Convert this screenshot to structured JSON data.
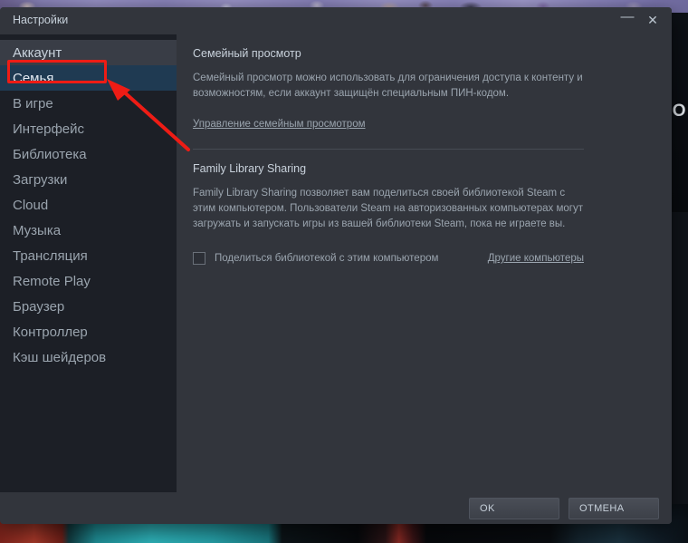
{
  "backdrop": {
    "visible_text_right": "НО"
  },
  "window": {
    "title": "Настройки",
    "controls": {
      "minimize": "—",
      "close": "✕"
    }
  },
  "sidebar": {
    "items": [
      {
        "label": "Аккаунт",
        "state": "hovered"
      },
      {
        "label": "Семья",
        "state": "selected"
      },
      {
        "label": "В игре",
        "state": "normal"
      },
      {
        "label": "Интерфейс",
        "state": "normal"
      },
      {
        "label": "Библиотека",
        "state": "normal"
      },
      {
        "label": "Загрузки",
        "state": "normal"
      },
      {
        "label": "Cloud",
        "state": "normal"
      },
      {
        "label": "Музыка",
        "state": "normal"
      },
      {
        "label": "Трансляция",
        "state": "normal"
      },
      {
        "label": "Remote Play",
        "state": "normal"
      },
      {
        "label": "Браузер",
        "state": "normal"
      },
      {
        "label": "Контроллер",
        "state": "normal"
      },
      {
        "label": "Кэш шейдеров",
        "state": "normal"
      }
    ]
  },
  "content": {
    "family_view": {
      "title": "Семейный просмотр",
      "description": "Семейный просмотр можно использовать для ограничения доступа к контенту и возможностям, если аккаунт защищён специальным ПИН-кодом.",
      "manage_link": "Управление семейным просмотром"
    },
    "family_sharing": {
      "title": "Family Library Sharing",
      "description": "Family Library Sharing позволяет вам поделиться своей библиотекой Steam с этим компьютером. Пользователи Steam на авторизованных компьютерах могут загружать и запускать игры из вашей библиотеки Steam, пока не играете вы.",
      "checkbox_label": "Поделиться библиотекой с этим компьютером",
      "checkbox_checked": false,
      "other_computers_link": "Другие компьютеры"
    }
  },
  "footer": {
    "ok_label": "OK",
    "cancel_label": "ОТМЕНА"
  },
  "annotations": {
    "highlight_color": "#ee1c15",
    "target": "Семья"
  }
}
